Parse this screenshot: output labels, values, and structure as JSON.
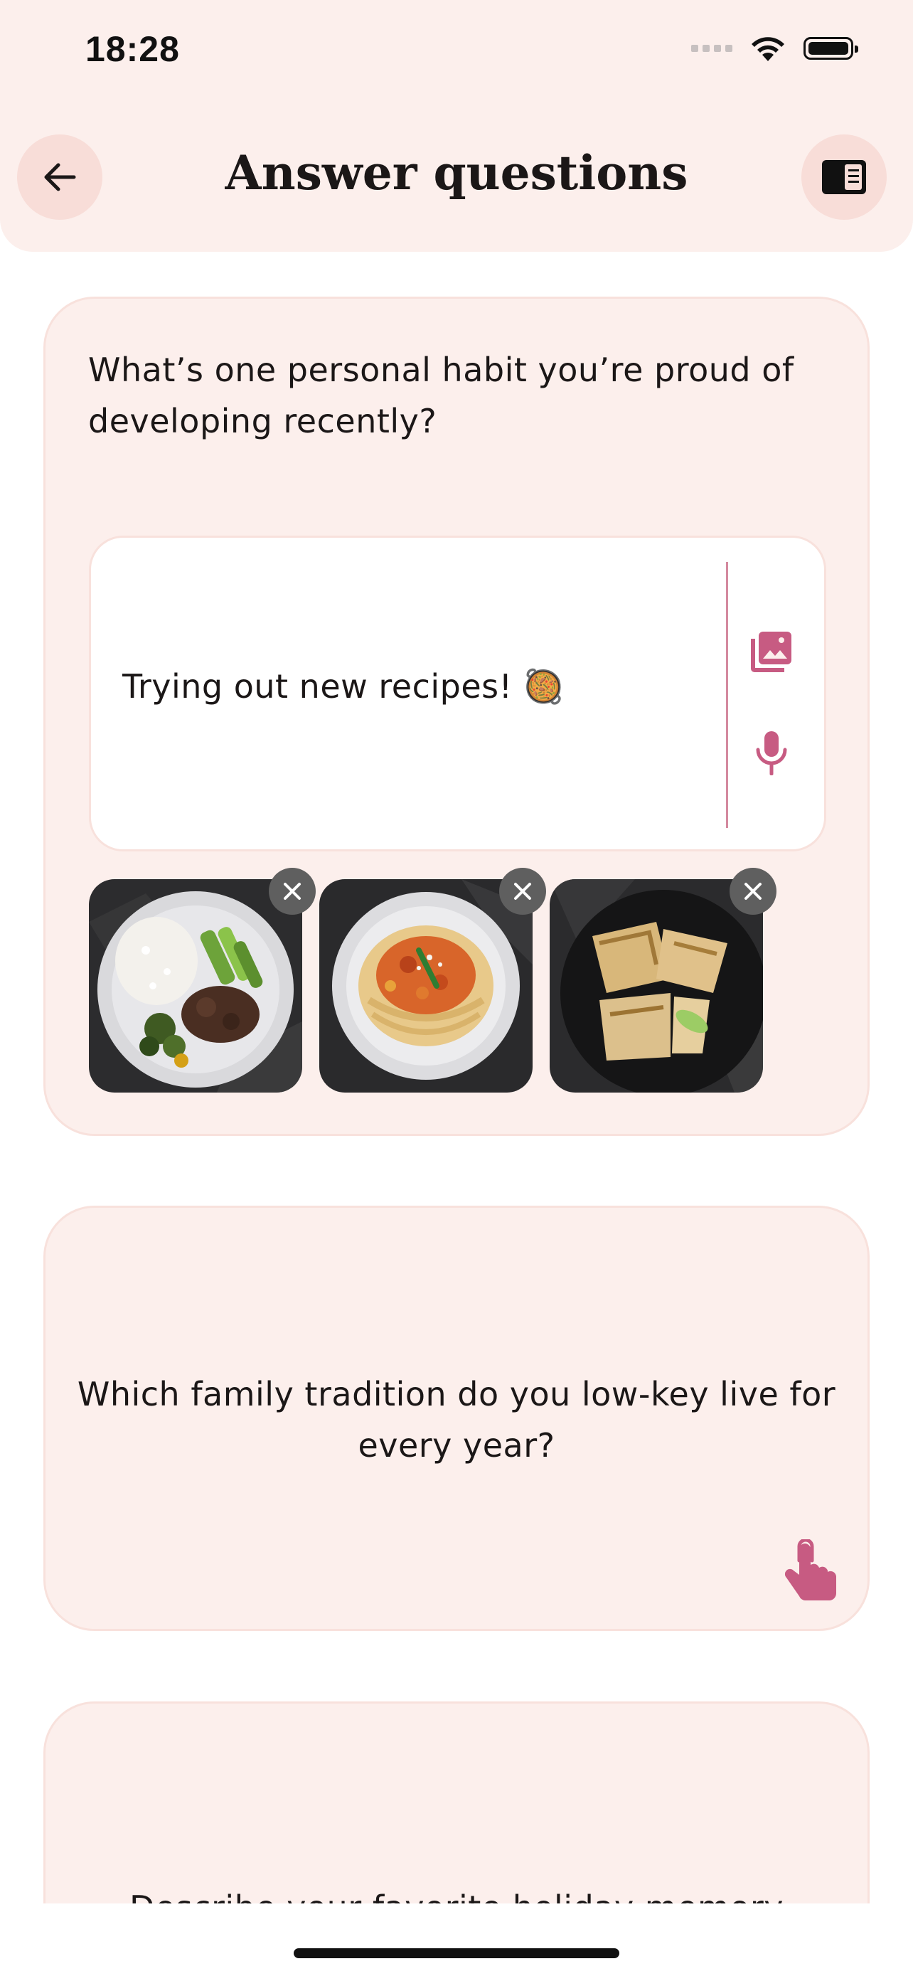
{
  "status_bar": {
    "time": "18:28"
  },
  "header": {
    "title": "Answer questions",
    "back_icon": "arrow-left-icon",
    "panel_icon": "reader-panel-icon"
  },
  "questions": [
    {
      "text": "What’s one personal habit you’re proud of developing recently?",
      "answer": "Trying out new recipes! 🥘",
      "actions": [
        "photo-library-icon",
        "microphone-icon"
      ],
      "attachments": [
        {
          "description_icon": "rice-beef-broccoli-photo"
        },
        {
          "description_icon": "pasta-photo"
        },
        {
          "description_icon": "wraps-photo"
        }
      ]
    },
    {
      "text": "Which family tradition do you low-key live for every year?",
      "action_icon": "tap-hand-icon"
    },
    {
      "text": "Describe your favorite holiday memory"
    }
  ],
  "colors": {
    "header_bg": "#fcefec",
    "card_bg": "#fcefec",
    "accent": "#c75b82",
    "circle_button_bg": "#f8ddd8"
  }
}
